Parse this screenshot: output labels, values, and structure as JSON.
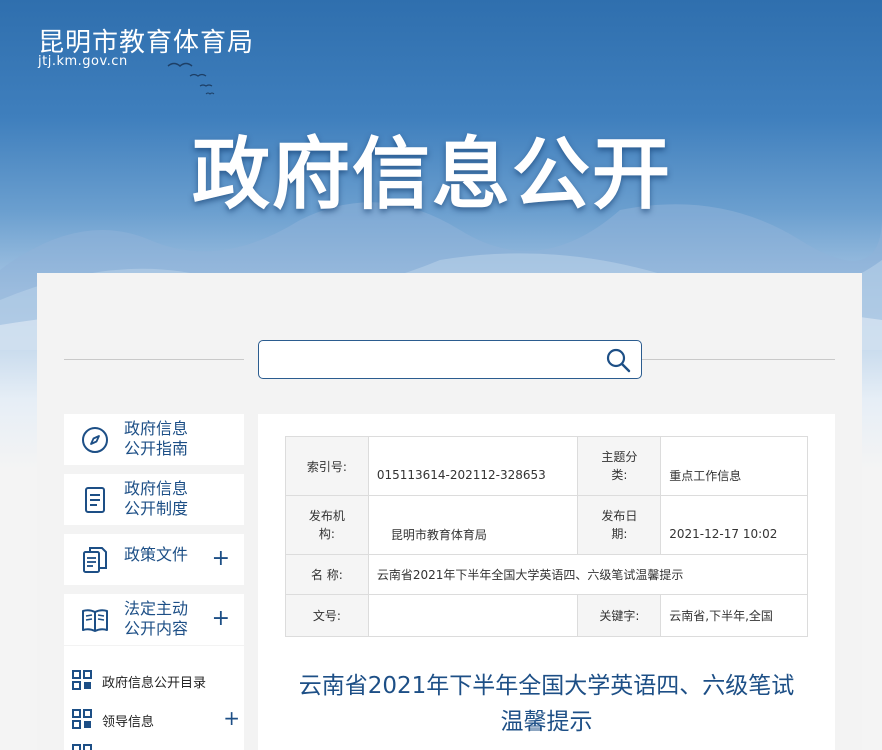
{
  "header": {
    "site_name": "昆明市教育体育局",
    "site_url": "jtj.km.gov.cn",
    "hero_title": "政府信息公开"
  },
  "search": {
    "value": "",
    "placeholder": ""
  },
  "sidebar": {
    "items": [
      {
        "line1": "政府信息",
        "line2": "公开指南",
        "icon": "compass-icon",
        "has_plus": false
      },
      {
        "line1": "政府信息",
        "line2": "公开制度",
        "icon": "document-icon",
        "has_plus": false
      },
      {
        "line1": "政策文件",
        "line2": "",
        "icon": "files-icon",
        "has_plus": true,
        "plus": "+"
      },
      {
        "line1": "法定主动",
        "line2": "公开内容",
        "icon": "book-icon",
        "has_plus": true,
        "plus": "+"
      }
    ],
    "sub_items": [
      {
        "label": "政府信息公开目录",
        "has_plus": false
      },
      {
        "label": "领导信息",
        "has_plus": true,
        "plus": "+"
      }
    ]
  },
  "meta": {
    "index_label": "索引号:",
    "index_value": "015113614-202112-328653",
    "topic_label_1": "主题分",
    "topic_label_2": "类:",
    "topic_value": "重点工作信息",
    "publisher_label_1": "发布机",
    "publisher_label_2": "构:",
    "publisher_value": "昆明市教育体育局",
    "date_label_1": "发布日",
    "date_label_2": "期:",
    "date_value": "2021-12-17 10:02",
    "name_label": "名 称:",
    "name_value": "云南省2021年下半年全国大学英语四、六级笔试温馨提示",
    "docno_label": "文号:",
    "docno_value": "",
    "keyword_label": "关键字:",
    "keyword_value": "云南省,下半年,全国"
  },
  "article": {
    "title_line1": "云南省2021年下半年全国大学英语四、六级笔试",
    "title_line2": "温馨提示"
  }
}
